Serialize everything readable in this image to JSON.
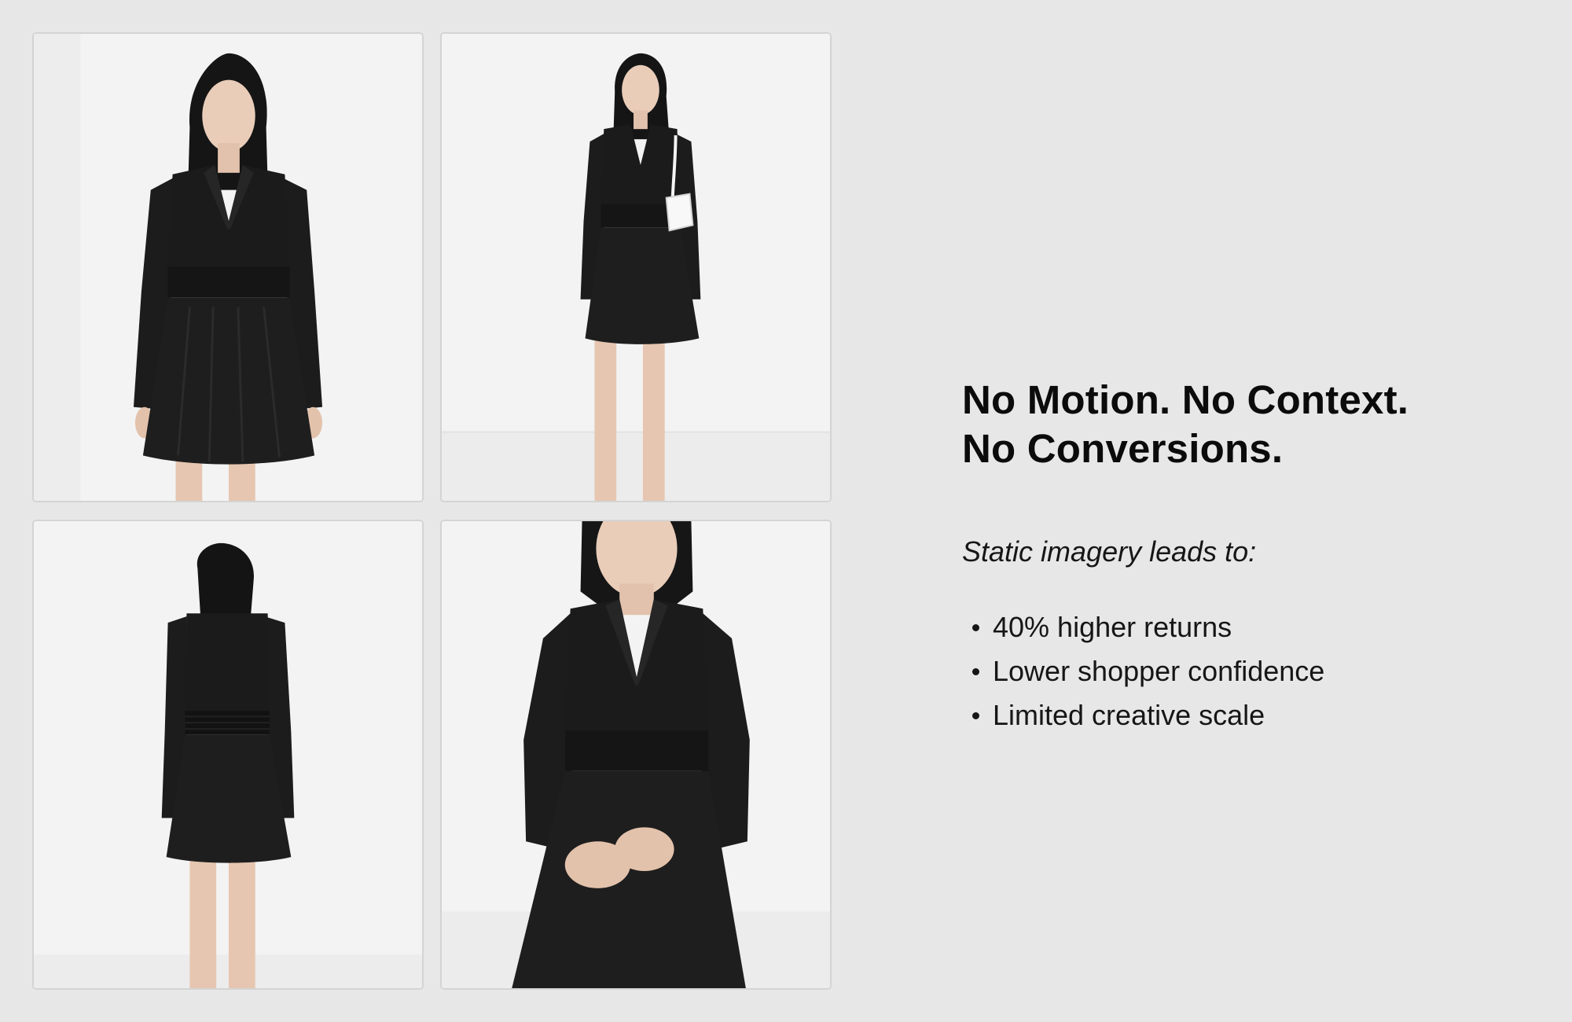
{
  "photos": [
    {
      "view": "front",
      "icon": "model-front-photo"
    },
    {
      "view": "full-length-with-bag",
      "icon": "model-full-length-photo"
    },
    {
      "view": "back",
      "icon": "model-back-photo"
    },
    {
      "view": "close-up",
      "icon": "model-closeup-photo"
    }
  ],
  "headline": {
    "line1": "No Motion. No Context.",
    "line2": "No Conversions."
  },
  "subhead": "Static imagery leads to:",
  "bullets": [
    "40% higher returns",
    "Lower shopper confidence",
    "Limited creative scale"
  ],
  "colors": {
    "background": "#e7e7e7",
    "photo_bg": "#f2f2f2",
    "dress": "#1b1b1b",
    "text": "#0b0b0b"
  }
}
